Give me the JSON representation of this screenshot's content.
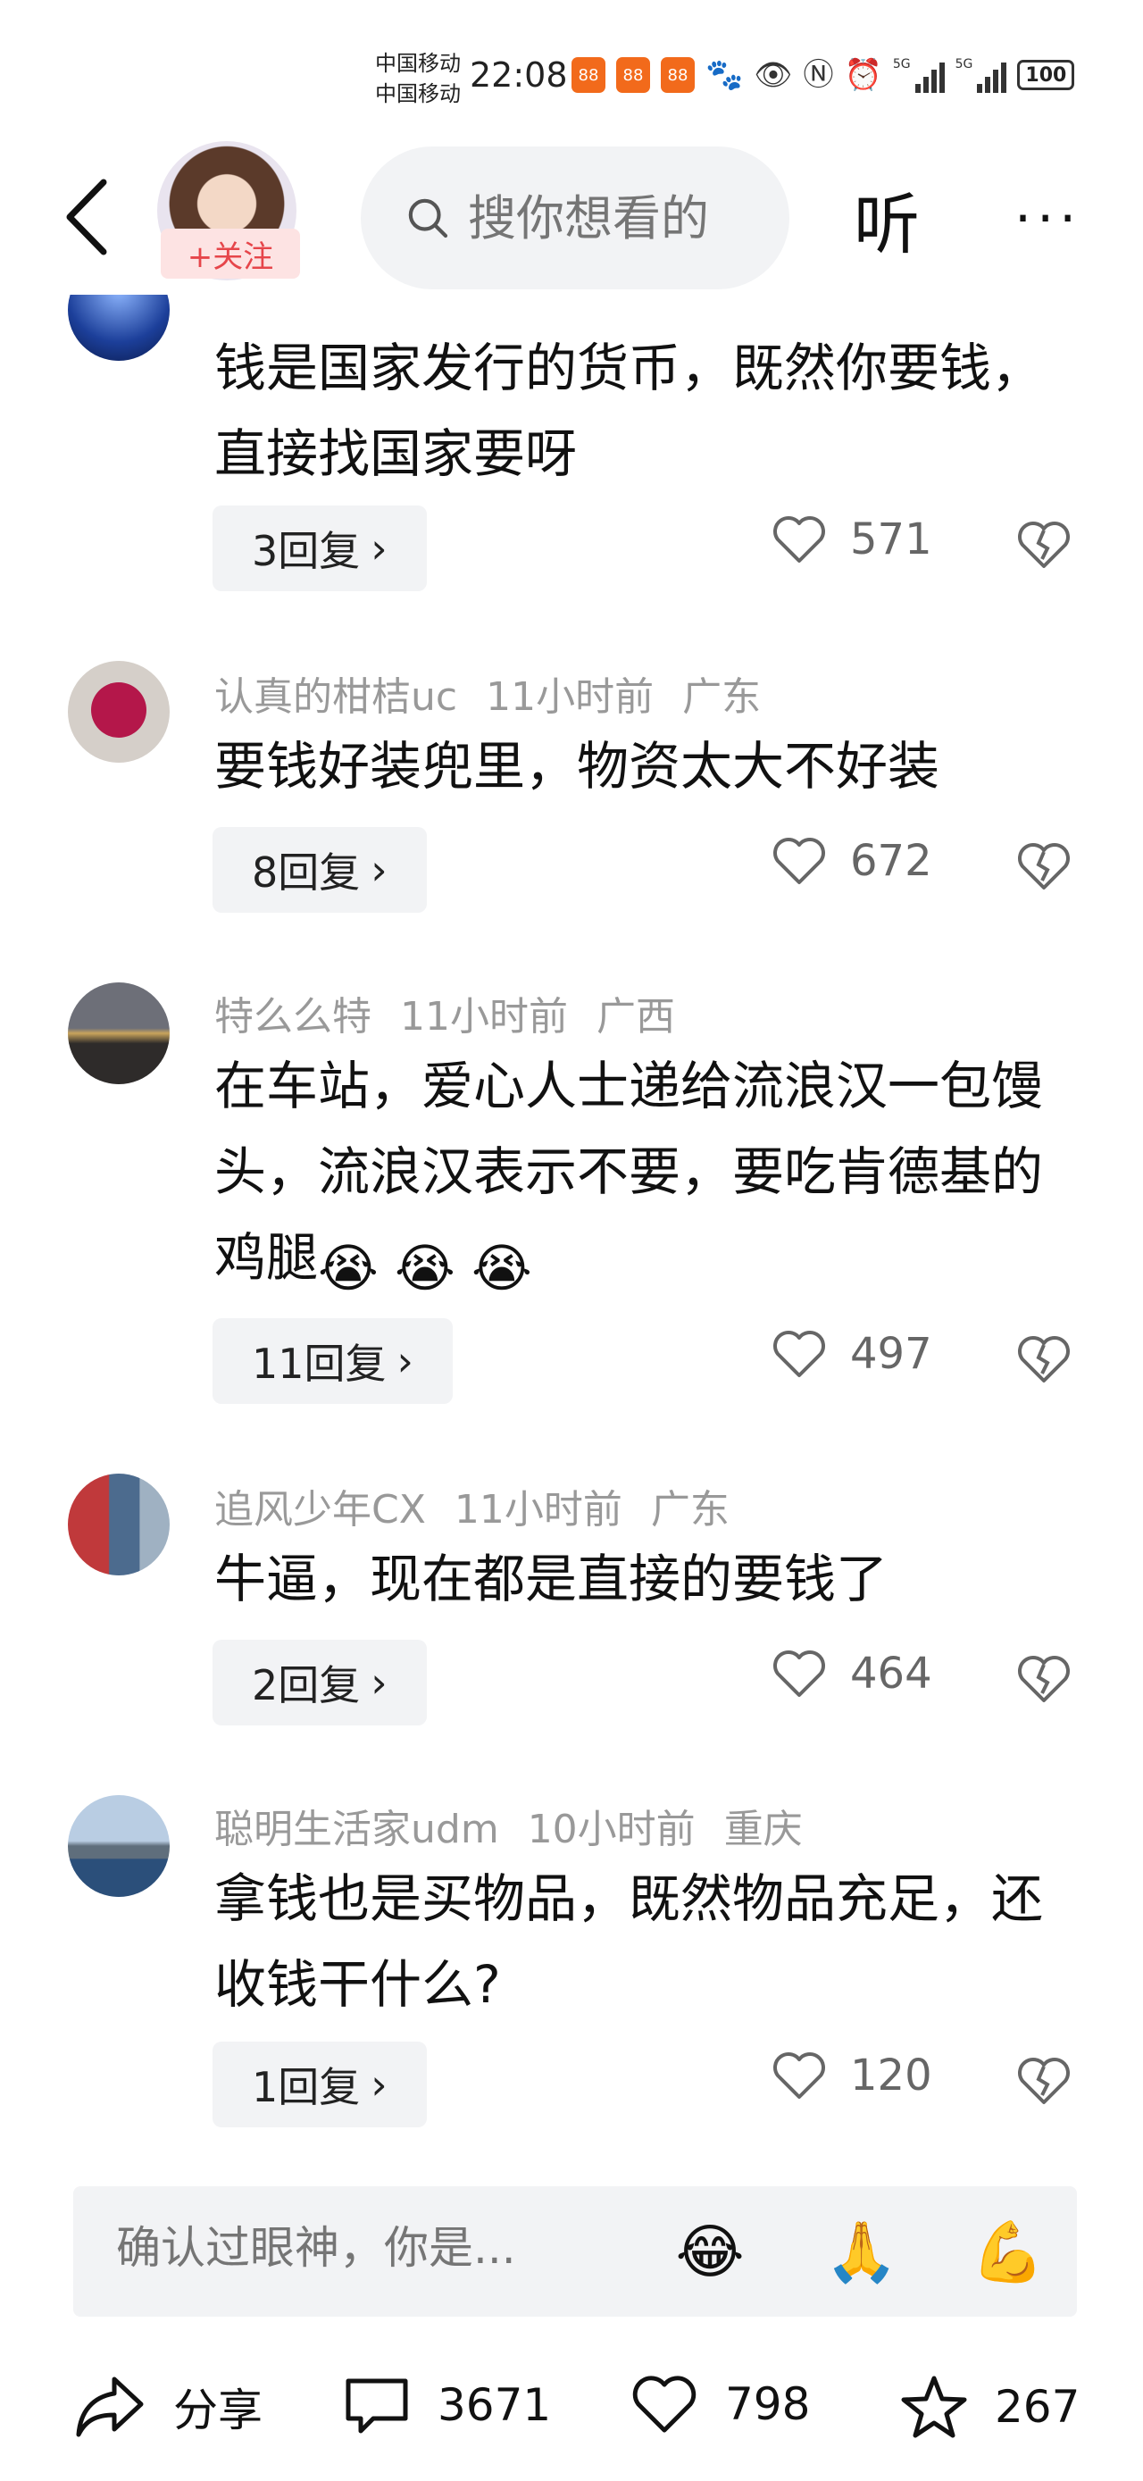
{
  "status_bar": {
    "carrier1": "中国移动",
    "carrier2": "中国移动",
    "time": "22:08",
    "network": "5G",
    "battery": "100"
  },
  "header": {
    "follow_label": "+关注",
    "search_placeholder": "搜你想看的",
    "listen_label": "听",
    "more_label": "···"
  },
  "comments": [
    {
      "text": "钱是国家发行的货币，既然你要钱，直接找国家要呀",
      "replies": "3回复",
      "likes": "571"
    },
    {
      "user": "认真的柑桔uc",
      "time": "11小时前",
      "location": "广东",
      "text": "要钱好装兜里，物资太大不好装",
      "replies": "8回复",
      "likes": "672"
    },
    {
      "user": "特么么特",
      "time": "11小时前",
      "location": "广西",
      "text": "在车站，爱心人士递给流浪汉一包馒头，流浪汉表示不要，要吃肯德基的鸡腿",
      "replies": "11回复",
      "likes": "497"
    },
    {
      "user": "追风少年CX",
      "time": "11小时前",
      "location": "广东",
      "text": "牛逼，现在都是直接的要钱了",
      "replies": "2回复",
      "likes": "464"
    },
    {
      "user": "聪明生活家udm",
      "time": "10小时前",
      "location": "重庆",
      "text": "拿钱也是买物品，既然物品充足，还收钱干什么?",
      "replies": "1回复",
      "likes": "120"
    }
  ],
  "input": {
    "placeholder": "确认过眼神，你是...",
    "emojis": [
      "😂",
      "🙏",
      "💪"
    ]
  },
  "bottom_bar": {
    "share_label": "分享",
    "comment_count": "3671",
    "like_count": "798",
    "favorite_count": "267"
  },
  "colors": {
    "follow_text": "#e6454a",
    "follow_bg": "#fde3e3",
    "meta_gray": "#999999",
    "chip_bg": "#f2f3f5"
  }
}
